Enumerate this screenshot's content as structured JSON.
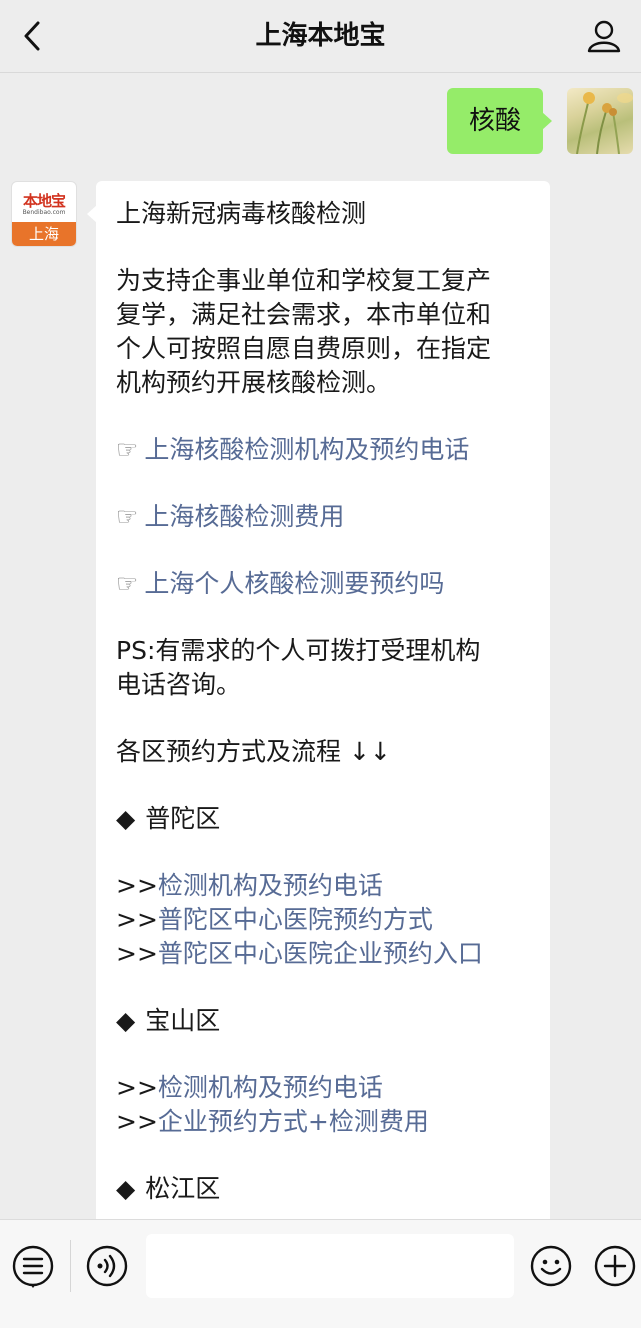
{
  "nav": {
    "title": "上海本地宝"
  },
  "chat": {
    "user_message": "核酸",
    "bot_avatar": {
      "brand": "本地宝",
      "domain": "Bendibao.com",
      "city": "上海"
    }
  },
  "card": {
    "title": "上海新冠病毒核酸检测",
    "intro_lines": [
      "为支持企事业单位和学校复工复产",
      "复学，满足社会需求，本市单位和",
      "个人可按照自愿自费原则，在指定",
      "机构预约开展核酸检测。"
    ],
    "hand_glyph": "☞",
    "links": [
      "上海核酸检测机构及预约电话",
      "上海核酸检测费用",
      "上海个人核酸检测要预约吗"
    ],
    "ps_lines": [
      "PS:有需求的个人可拨打受理机构",
      "电话咨询。"
    ],
    "process_heading": "各区预约方式及流程 ↓↓",
    "diamond_glyph": "◆",
    "prefix": ">>",
    "districts": [
      {
        "name": "普陀区",
        "links": [
          "检测机构及预约电话",
          "普陀区中心医院预约方式",
          "普陀区中心医院企业预约入口"
        ]
      },
      {
        "name": "宝山区",
        "links": [
          "检测机构及预约电话",
          "企业预约方式+检测费用"
        ]
      },
      {
        "name": "松江区",
        "links": []
      }
    ]
  },
  "colors": {
    "link": "#576b95",
    "bubble_green": "#95ec69",
    "background": "#ededed",
    "brand_orange": "#e8742a"
  },
  "icons": {
    "nav_back": "back-arrow-icon",
    "nav_profile": "profile-icon",
    "bottom_menu": "menu-list-icon",
    "bottom_voice": "voice-icon",
    "bottom_emoji": "emoji-icon",
    "bottom_add": "add-icon"
  }
}
